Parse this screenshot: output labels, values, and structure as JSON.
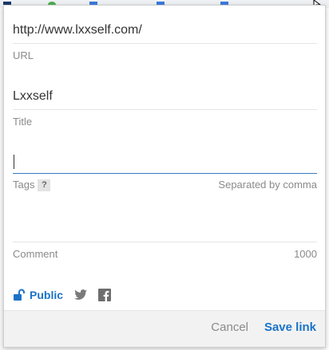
{
  "form": {
    "url_value": "http://www.lxxself.com/",
    "url_label": "URL",
    "title_value": "Lxxself",
    "title_label": "Title",
    "tags_value": "",
    "tags_label": "Tags",
    "tags_help": "?",
    "tags_hint": "Separated by comma",
    "comment_value": "",
    "comment_label": "Comment",
    "comment_limit": "1000"
  },
  "share": {
    "visibility_label": "Public",
    "icons": [
      "unlock-icon",
      "twitter-icon",
      "facebook-icon"
    ]
  },
  "footer": {
    "cancel_label": "Cancel",
    "save_label": "Save link"
  },
  "colors": {
    "accent": "#1a73c8",
    "muted_text": "#8a8a8a",
    "footer_bg": "#f2f2f2"
  }
}
